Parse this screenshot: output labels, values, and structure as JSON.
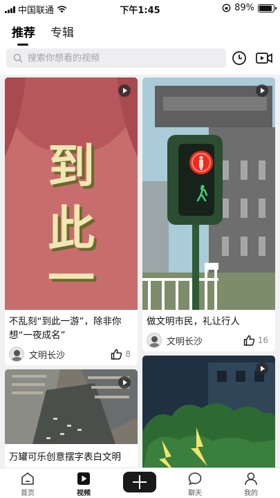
{
  "status_bar": {
    "carrier": "中国联通",
    "time": "下午1:45",
    "battery": "89%",
    "battery_level": 0.89
  },
  "header": {
    "tabs": [
      {
        "label": "推荐",
        "active": true
      },
      {
        "label": "专辑",
        "active": false
      }
    ],
    "search": {
      "placeholder": "搜索你想看的视频",
      "value": ""
    },
    "icons": [
      "clock-icon",
      "video-record-icon"
    ]
  },
  "feed": {
    "cards": [
      {
        "title": "不乱刻“到此一游”，除非你想“一夜成名”",
        "thumb_text": [
          "到",
          "此",
          "一"
        ],
        "author": "文明长沙",
        "likes": "8"
      },
      {
        "title": "做文明市民，礼让行人",
        "author": "文明长沙",
        "likes": "16"
      },
      {
        "title": "万罐可乐创意摆字表白文明"
      },
      {
        "title": ""
      }
    ]
  },
  "bottom_nav": {
    "items": [
      {
        "label": "首页",
        "icon": "home-icon",
        "active": false
      },
      {
        "label": "视频",
        "icon": "video-icon",
        "active": true
      },
      {
        "label": "",
        "icon": "plus-icon",
        "active": false
      },
      {
        "label": "聊天",
        "icon": "chat-icon",
        "active": false
      },
      {
        "label": "我的",
        "icon": "profile-icon",
        "active": false
      }
    ]
  }
}
